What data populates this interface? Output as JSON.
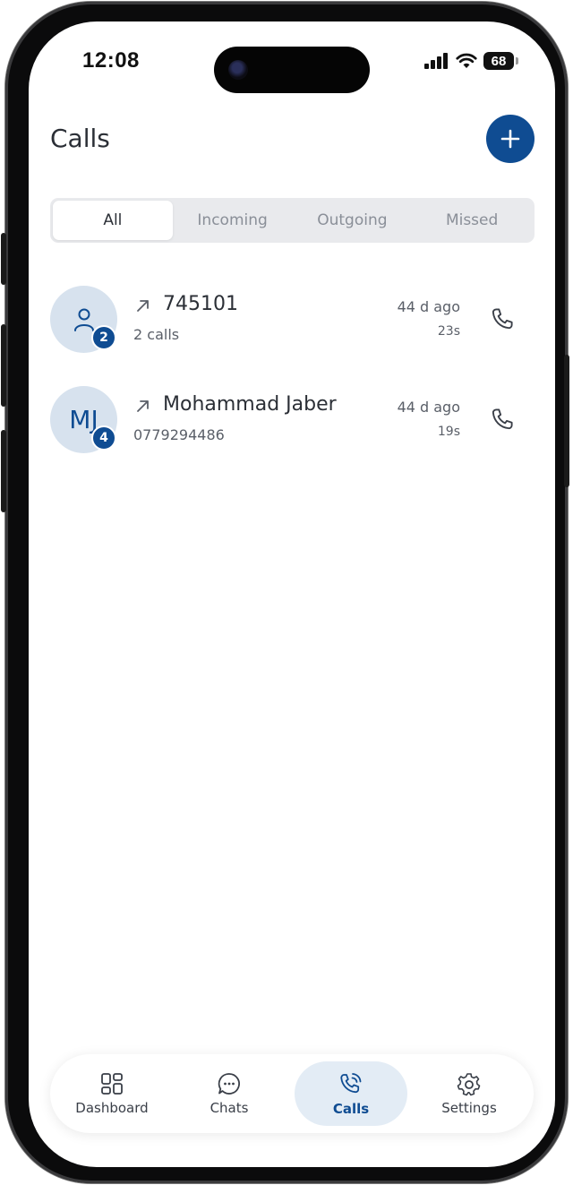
{
  "status_bar": {
    "time": "12:08",
    "battery": "68"
  },
  "header": {
    "title": "Calls",
    "add_icon": "plus-icon"
  },
  "tabs": [
    {
      "label": "All",
      "active": true
    },
    {
      "label": "Incoming",
      "active": false
    },
    {
      "label": "Outgoing",
      "active": false
    },
    {
      "label": "Missed",
      "active": false
    }
  ],
  "calls": [
    {
      "avatar": "person-icon",
      "initials": "",
      "badge": "2",
      "direction": "outgoing-arrow-icon",
      "name": "745101",
      "subtitle": "2 calls",
      "time_ago": "44 d ago",
      "duration": "23s"
    },
    {
      "avatar": "initials",
      "initials": "MJ",
      "badge": "4",
      "direction": "outgoing-arrow-icon",
      "name": "Mohammad Jaber",
      "subtitle": "0779294486",
      "time_ago": "44 d ago",
      "duration": "19s"
    }
  ],
  "bottom_nav": [
    {
      "label": "Dashboard",
      "icon": "grid-icon",
      "active": false
    },
    {
      "label": "Chats",
      "icon": "chat-bubble-icon",
      "active": false
    },
    {
      "label": "Calls",
      "icon": "phone-wave-icon",
      "active": true
    },
    {
      "label": "Settings",
      "icon": "gear-icon",
      "active": false
    }
  ],
  "colors": {
    "accent": "#0f4c92",
    "avatar_bg": "#d7e2ee",
    "tab_bg": "#e9eaed",
    "active_nav_bg": "#e3ecf5"
  }
}
